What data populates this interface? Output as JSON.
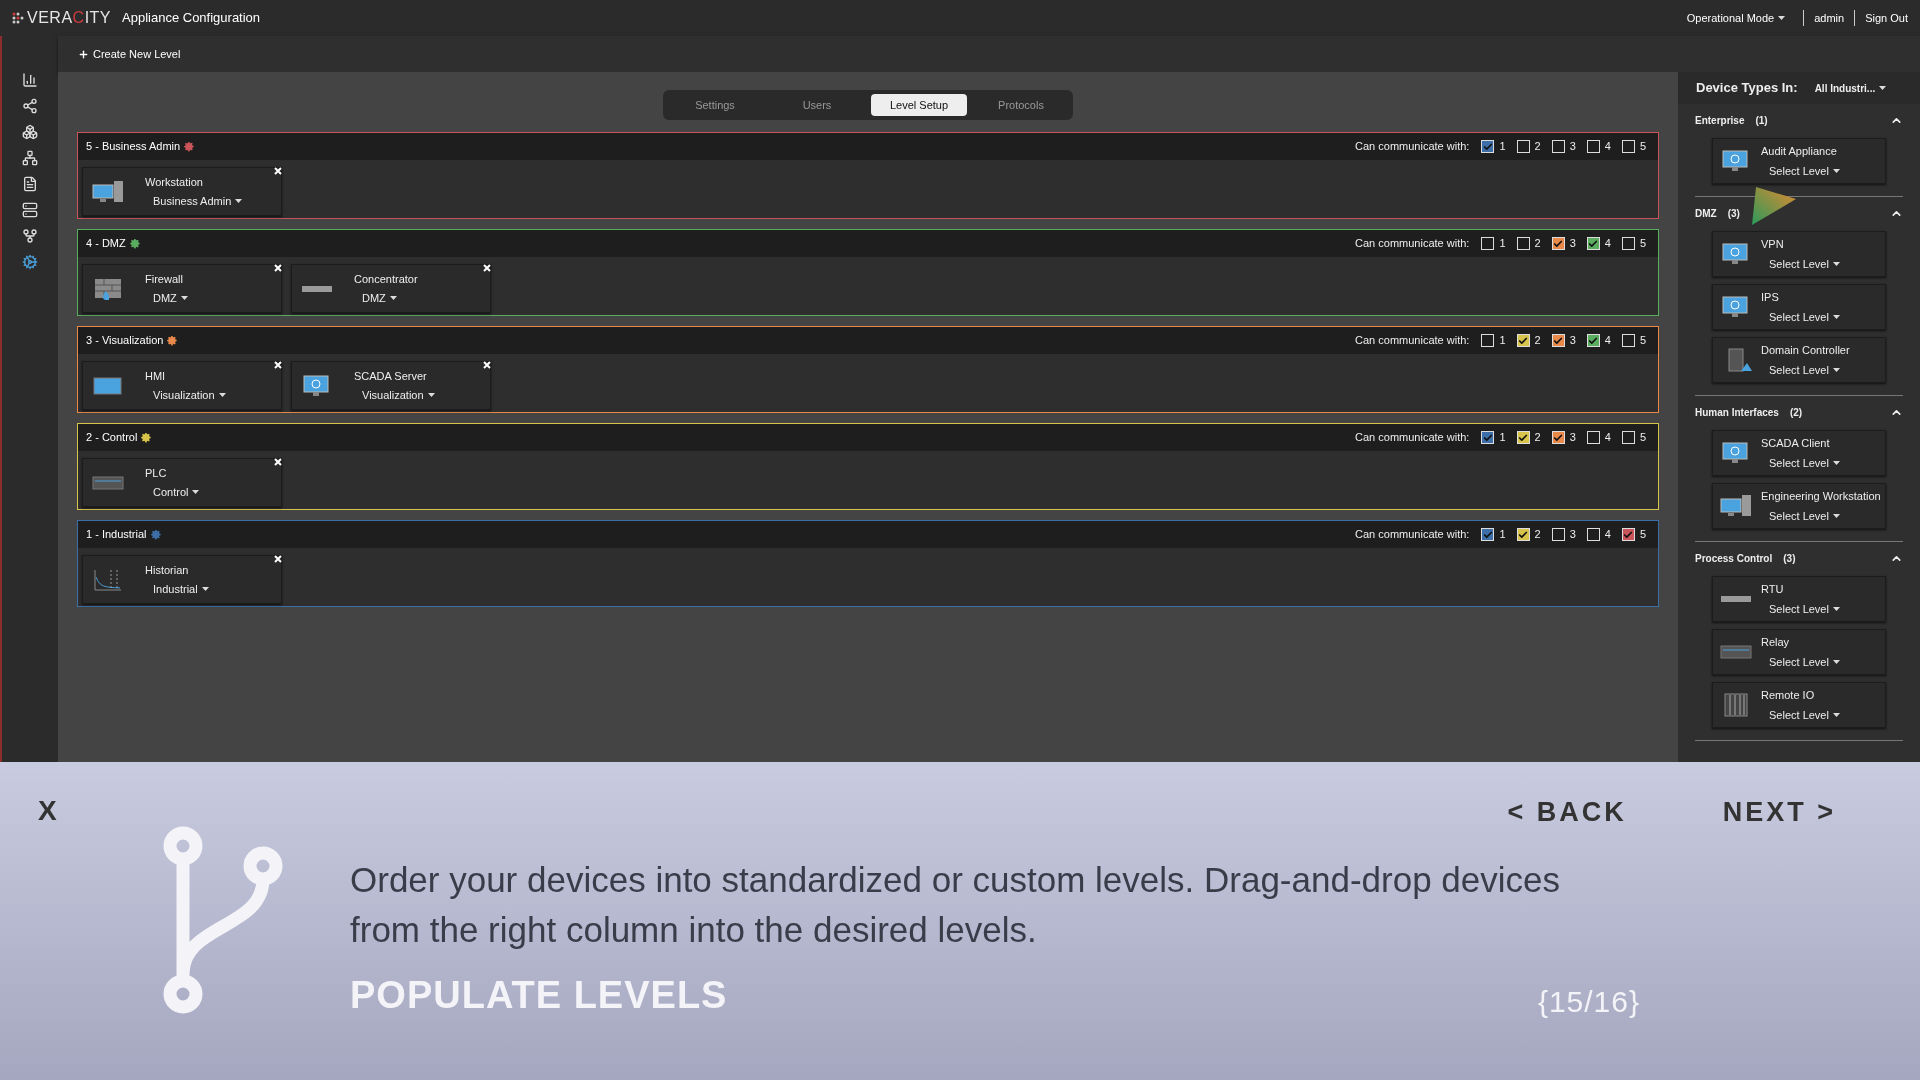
{
  "header": {
    "logo": [
      {
        "text": "VERA",
        "color": "#e6e6e6"
      },
      {
        "text": "C",
        "color": "#d23a3f"
      },
      {
        "text": "ITY",
        "color": "#e6e6e6"
      }
    ],
    "app_title": "Appliance Configuration",
    "mode_menu": "Operational Mode",
    "user": "admin",
    "sign_out": "Sign Out"
  },
  "toolbar": {
    "create_button": "Create New Level"
  },
  "sidebar": {
    "items": [
      {
        "kind": "chart",
        "selected": false
      },
      {
        "kind": "share",
        "selected": false
      },
      {
        "kind": "cubes",
        "selected": false
      },
      {
        "kind": "hierarchy",
        "selected": false
      },
      {
        "kind": "document",
        "selected": false
      },
      {
        "kind": "servers",
        "selected": false
      },
      {
        "kind": "fork",
        "selected": false
      },
      {
        "kind": "gears",
        "selected": true
      }
    ]
  },
  "tabs": [
    {
      "label": "Settings",
      "selected": false
    },
    {
      "label": "Users",
      "selected": false
    },
    {
      "label": "Level Setup",
      "selected": true
    },
    {
      "label": "Protocols",
      "selected": false
    }
  ],
  "levels": [
    {
      "title": "5 - Business Admin",
      "color": "#c9555a",
      "communicate_label": "Can communicate with:",
      "checks": [
        {
          "label": "1",
          "checked": true
        },
        {
          "label": "2",
          "checked": false
        },
        {
          "label": "3",
          "checked": false
        },
        {
          "label": "4",
          "checked": false
        },
        {
          "label": "5",
          "checked": false
        }
      ],
      "devices": [
        {
          "name": "Workstation",
          "level": "Business Admin",
          "kind": "computer"
        }
      ]
    },
    {
      "title": "4 - DMZ",
      "color": "#5aac5f",
      "communicate_label": "Can communicate with:",
      "checks": [
        {
          "label": "1",
          "checked": false
        },
        {
          "label": "2",
          "checked": false
        },
        {
          "label": "3",
          "checked": true
        },
        {
          "label": "4",
          "checked": true
        },
        {
          "label": "5",
          "checked": false
        }
      ],
      "devices": [
        {
          "name": "Firewall",
          "level": "DMZ",
          "kind": "wall"
        },
        {
          "name": "Concentrator",
          "level": "DMZ",
          "kind": "slim"
        }
      ]
    },
    {
      "title": "3 - Visualization",
      "color": "#e8894a",
      "communicate_label": "Can communicate with:",
      "checks": [
        {
          "label": "1",
          "checked": false
        },
        {
          "label": "2",
          "checked": true
        },
        {
          "label": "3",
          "checked": true
        },
        {
          "label": "4",
          "checked": true
        },
        {
          "label": "5",
          "checked": false
        }
      ],
      "devices": [
        {
          "name": "HMI",
          "level": "Visualization",
          "kind": "panel"
        },
        {
          "name": "SCADA Server",
          "level": "Visualization",
          "kind": "monitor"
        }
      ]
    },
    {
      "title": "2 - Control",
      "color": "#d8c44a",
      "communicate_label": "Can communicate with:",
      "checks": [
        {
          "label": "1",
          "checked": true
        },
        {
          "label": "2",
          "checked": true
        },
        {
          "label": "3",
          "checked": true
        },
        {
          "label": "4",
          "checked": false
        },
        {
          "label": "5",
          "checked": false
        }
      ],
      "devices": [
        {
          "name": "PLC",
          "level": "Control",
          "kind": "box"
        }
      ]
    },
    {
      "title": "1 - Industrial",
      "color": "#3d6ea8",
      "communicate_label": "Can communicate with:",
      "checks": [
        {
          "label": "1",
          "checked": true
        },
        {
          "label": "2",
          "checked": true
        },
        {
          "label": "3",
          "checked": false
        },
        {
          "label": "4",
          "checked": false
        },
        {
          "label": "5",
          "checked": true
        }
      ],
      "devices": [
        {
          "name": "Historian",
          "level": "Industrial",
          "kind": "chart"
        }
      ]
    }
  ],
  "device_panel": {
    "title": "Device Types In:",
    "filter": "All Industri...",
    "groups": [
      {
        "name": "Enterprise",
        "count": "(1)",
        "expanded": true,
        "devices": [
          {
            "name": "Audit Appliance",
            "level": "Select Level",
            "kind": "monitor"
          }
        ]
      },
      {
        "name": "DMZ",
        "count": "(3)",
        "expanded": true,
        "devices": [
          {
            "name": "VPN",
            "level": "Select Level",
            "kind": "monitor"
          },
          {
            "name": "IPS",
            "level": "Select Level",
            "kind": "monitor"
          },
          {
            "name": "Domain Controller",
            "level": "Select Level",
            "kind": "tower"
          }
        ]
      },
      {
        "name": "Human Interfaces",
        "count": "(2)",
        "expanded": true,
        "devices": [
          {
            "name": "SCADA Client",
            "level": "Select Level",
            "kind": "monitor"
          },
          {
            "name": "Engineering Workstation",
            "level": "Select Level",
            "kind": "computer"
          }
        ]
      },
      {
        "name": "Process Control",
        "count": "(3)",
        "expanded": true,
        "devices": [
          {
            "name": "RTU",
            "level": "Select Level",
            "kind": "slim"
          },
          {
            "name": "Relay",
            "level": "Select Level",
            "kind": "box"
          },
          {
            "name": "Remote IO",
            "level": "Select Level",
            "kind": "rack"
          }
        ]
      }
    ]
  },
  "tour": {
    "close": "X",
    "back": "< BACK",
    "next": "NEXT >",
    "text": "Order your devices into standardized or custom levels. Drag-and-drop devices from the right column into the desired levels.",
    "title": "POPULATE LEVELS",
    "step": "{15/16}"
  }
}
